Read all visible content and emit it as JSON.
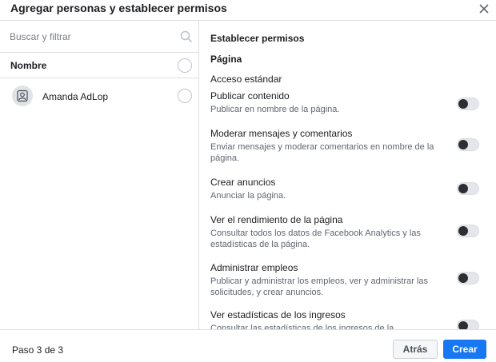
{
  "header": {
    "title": "Agregar personas y establecer permisos",
    "close_icon": "close-icon"
  },
  "left": {
    "search": {
      "placeholder": "Buscar y filtrar",
      "value": "",
      "icon": "search-icon"
    },
    "name_header": "Nombre",
    "people": [
      {
        "name": "Amanda AdLop",
        "avatar_icon": "user-avatar-icon"
      }
    ]
  },
  "right": {
    "title": "Establecer permisos",
    "section": "Página",
    "subsection": "Acceso estándar",
    "permissions": [
      {
        "title": "Publicar contenido",
        "desc": "Publicar en nombre de la página.",
        "enabled": false
      },
      {
        "title": "Moderar mensajes y comentarios",
        "desc": "Enviar mensajes y moderar comentarios en nombre de la página.",
        "enabled": false
      },
      {
        "title": "Crear anuncios",
        "desc": "Anunciar la página.",
        "enabled": false
      },
      {
        "title": "Ver el rendimiento de la página",
        "desc": "Consultar todos los datos de Facebook Analytics y las estadísticas de la página.",
        "enabled": false
      },
      {
        "title": "Administrar empleos",
        "desc": "Publicar y administrar los empleos, ver y administrar las solicitudes, y crear anuncios.",
        "enabled": false
      },
      {
        "title": "Ver estadísticas de los ingresos",
        "desc": "Consultar las estadísticas de los ingresos de la",
        "enabled": false
      }
    ]
  },
  "footer": {
    "step": "Paso 3 de 3",
    "back_label": "Atrás",
    "create_label": "Crear"
  },
  "colors": {
    "primary": "#1877f2",
    "border": "#dddfe2",
    "secondary_text": "#606770"
  }
}
